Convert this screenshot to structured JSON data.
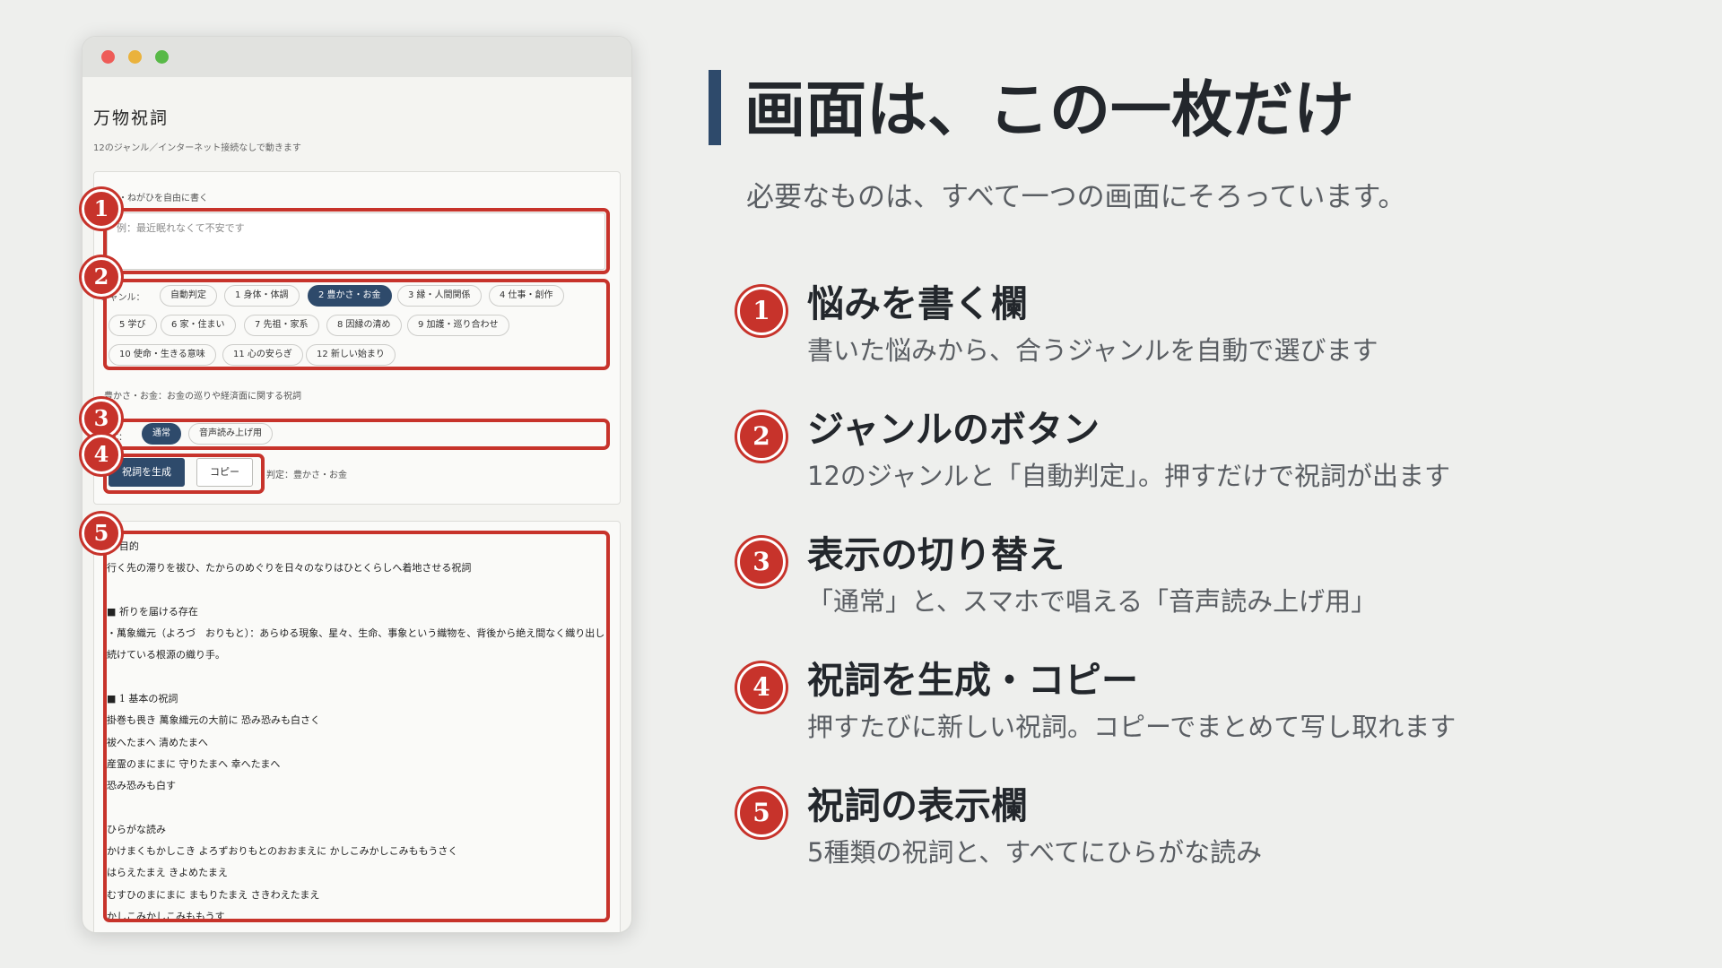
{
  "app": {
    "title": "万物祝詞",
    "subtitle": "12のジャンル／インターネット接続なしで動きます",
    "textarea_label": "悩み・ねがひを自由に書く",
    "textarea_placeholder": "例：最近眠れなくて不安です",
    "genre_label": "ジャンル：",
    "genres": [
      "自動判定",
      "1 身体・体調",
      "2 豊かさ・お金",
      "3 縁・人間関係",
      "4 仕事・創作",
      "5 学び",
      "6 家・住まい",
      "7 先祖・家系",
      "8 因縁の清め",
      "9 加護・巡り合わせ",
      "10 使命・生きる意味",
      "11 心の安らぎ",
      "12 新しい始まり"
    ],
    "selected_genre": "2 豊かさ・お金",
    "genre_description": "豊かさ・お金：お金の巡りや経済面に関する祝詞",
    "format_label": "形式：",
    "format_options": [
      "通常",
      "音声読み上げ用"
    ],
    "selected_format": "通常",
    "generate_button": "祝詞を生成",
    "copy_button": "コピー",
    "judgement": "判定：豊かさ・お金",
    "output": "■ 目的\n行く先の滞りを祓ひ、たからのめぐりを日々のなりはひとくらしへ着地させる祝詞\n\n■ 祈りを届ける存在\n・萬象織元（よろづ　おりもと）：あらゆる現象、星々、生命、事象という織物を、背後から絶え間なく織り出し続けている根源の織り手。\n\n■ 1 基本の祝詞\n掛巻も畏き 萬象織元の大前に 恐み恐みも白さく\n祓へたまへ 清めたまへ\n産霊のまにまに 守りたまへ 幸へたまへ\n恐み恐みも白す\n\nひらがな読み\nかけまくもかしこき よろずおりもとのおおまえに かしこみかしこみももうさく\nはらえたまえ きよめたまえ\nむすひのまにまに まもりたまえ さきわえたまえ\nかしこみかしこみももうす"
  },
  "badges": [
    "1",
    "2",
    "3",
    "4",
    "5"
  ],
  "panel": {
    "title": "画面は、この一枚だけ",
    "subtitle": "必要なものは、すべて一つの画面にそろっています。",
    "features": [
      {
        "num": "1",
        "title": "悩みを書く欄",
        "desc": "書いた悩みから、合うジャンルを自動で選びます"
      },
      {
        "num": "2",
        "title": "ジャンルのボタン",
        "desc": "12のジャンルと「自動判定」。押すだけで祝詞が出ます"
      },
      {
        "num": "3",
        "title": "表示の切り替え",
        "desc": "「通常」と、スマホで唱える「音声読み上げ用」"
      },
      {
        "num": "4",
        "title": "祝詞を生成・コピー",
        "desc": "押すたびに新しい祝詞。コピーでまとめて写し取れます"
      },
      {
        "num": "5",
        "title": "祝詞の表示欄",
        "desc": "5種類の祝詞と、すべてにひらがな読み"
      }
    ]
  },
  "colors": {
    "accent": "#c7332b",
    "navy": "#2e4a6b",
    "background": "#eeefed"
  }
}
